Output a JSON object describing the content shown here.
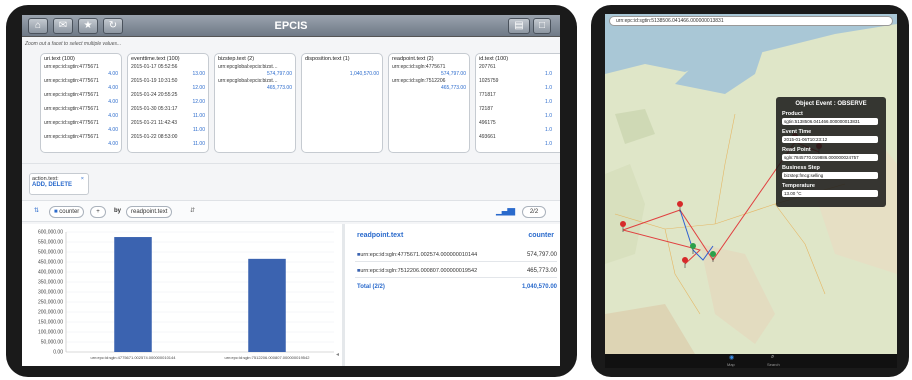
{
  "left": {
    "title": "EPCIS",
    "hint": "Zoom out a facet to select multiple values...",
    "facets": [
      {
        "header": "uri.text (100)",
        "rows": [
          {
            "k": "urn:epc:id:sgtin:4775671",
            "v": "4.00"
          },
          {
            "k": "urn:epc:id:sgtin:4775671",
            "v": "4.00"
          },
          {
            "k": "urn:epc:id:sgtin:4775671",
            "v": "4.00"
          },
          {
            "k": "urn:epc:id:sgtin:4775671",
            "v": "4.00"
          },
          {
            "k": "urn:epc:id:sgtin:4775671",
            "v": "4.00"
          },
          {
            "k": "urn:epc:id:sgtin:4775671",
            "v": "4.00"
          }
        ]
      },
      {
        "header": "eventtime.text (100)",
        "rows": [
          {
            "k": "2015-01-17 05:52:56",
            "v": "13.00"
          },
          {
            "k": "2015-01-19 10:31:50",
            "v": "12.00"
          },
          {
            "k": "2015-01-24 20:55:25",
            "v": "12.00"
          },
          {
            "k": "2015-01-30 05:31:17",
            "v": "11.00"
          },
          {
            "k": "2015-01-21 11:42:43",
            "v": "11.00"
          },
          {
            "k": "2015-01-22 08:53:00",
            "v": "11.00"
          }
        ]
      },
      {
        "header": "bizstep.text (2)",
        "rows": [
          {
            "k": "urn:epcglobal:epcis:bizst…",
            "v": "574,797.00"
          },
          {
            "k": "urn:epcglobal:epcis:bizst…",
            "v": "465,773.00"
          }
        ]
      },
      {
        "header": "disposition.text (1)",
        "rows": [
          {
            "k": "",
            "v": "1,040,570.00"
          }
        ]
      },
      {
        "header": "readpoint.text (2)",
        "rows": [
          {
            "k": "urn:epc:id:sgln:4775671",
            "v": "574,797.00"
          },
          {
            "k": "urn:epc:id:sgln:7512206",
            "v": "465,773.00"
          }
        ]
      },
      {
        "header": "id.text (100)",
        "rows": [
          {
            "k": "207761",
            "v": "1.0"
          },
          {
            "k": "1025759",
            "v": "1.0"
          },
          {
            "k": "771817",
            "v": "1.0"
          },
          {
            "k": "72187",
            "v": "1.0"
          },
          {
            "k": "496175",
            "v": "1.0"
          },
          {
            "k": "493661",
            "v": "1.0"
          }
        ]
      }
    ],
    "selection": {
      "label": "action.text:",
      "value": "ADD, DELETE",
      "close": "×"
    },
    "controls": {
      "measure": "counter",
      "plus": "+",
      "by": "by",
      "dimension": "readpoint.text",
      "pager": "2/2"
    },
    "table": {
      "col1": "readpoint.text",
      "col2": "counter",
      "rows": [
        {
          "k": "urn:epc:id:sgln:4775671.002574.000000010144",
          "v": "574,797.00"
        },
        {
          "k": "urn:epc:id:sgln:7512206.000807.000000019542",
          "v": "465,773.00"
        }
      ],
      "total_label": "Total (2/2)",
      "total_value": "1,040,570.00"
    }
  },
  "right": {
    "search": "urn:epc:id:sgtin:5138506.041466.000000013831",
    "popup": {
      "title": "Object Event : OBSERVE",
      "fields": [
        {
          "k": "Product",
          "v": "sgtin:5138506.041466.000000013831"
        },
        {
          "k": "Event Time",
          "v": "2015-01-06T10:23:12"
        },
        {
          "k": "Read Point",
          "v": "sgln:7845770.019886.000000024757"
        },
        {
          "k": "Business Step",
          "v": "bizstep:fmcg:selling"
        },
        {
          "k": "Temperature",
          "v": "13.00 °C"
        }
      ]
    },
    "tabs": [
      "Map",
      "Search"
    ]
  },
  "chart_data": {
    "type": "bar",
    "categories": [
      "urn:epc:id:sgln:4775671.002574.000000010144",
      "urn:epc:id:sgln:7512206.000807.000000019542"
    ],
    "values": [
      574797,
      465773
    ],
    "yticks": [
      "600,000.00",
      "550,000.00",
      "500,000.00",
      "450,000.00",
      "400,000.00",
      "350,000.00",
      "300,000.00",
      "250,000.00",
      "200,000.00",
      "150,000.00",
      "100,000.00",
      "50,000.00",
      "0.00"
    ],
    "ylim": [
      0,
      600000
    ],
    "color": "#3b63b0"
  }
}
